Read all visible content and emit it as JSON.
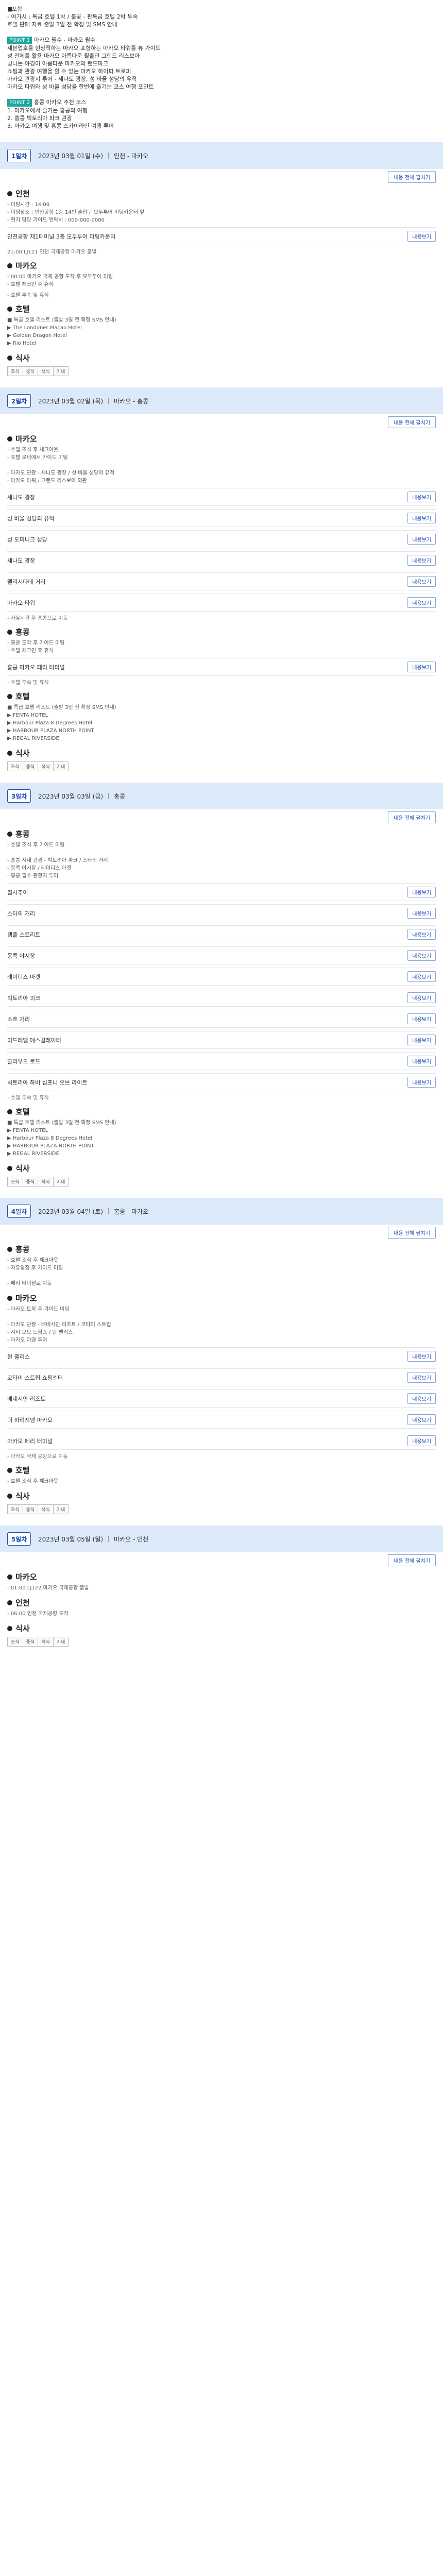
{
  "intro": {
    "lines": [
      {
        "type": "bullet",
        "text": "포함"
      },
      {
        "type": "plain",
        "text": " - 여가시 : 특급 호텔 1박 / 불꽃 - 판특급 호텔 2박 투숙"
      },
      {
        "type": "plain",
        "text": " 호텔 판매 자료 출발 3일 전 확정 및 SMS 안내"
      },
      {
        "type": "blank",
        "text": ""
      },
      {
        "type": "badge",
        "badge": "POINT 1",
        "text": "마카오 필수 - 마카오 필수"
      },
      {
        "type": "plain",
        "text": " 세븐업호를 현상적하는 마카오 포함하는 마카오 타워를 뷰 가이드"
      },
      {
        "type": "plain",
        "text": " 성 전체를 활용 마카오 아름다운 월출인 그랜드 리스보아"
      },
      {
        "type": "plain",
        "text": " 빛나는 야경이 아름다운 마카오의 랜드마크"
      },
      {
        "type": "plain",
        "text": " 쇼핑과 관광 여행을 할 수 있는 마카오 하이파 트로피"
      },
      {
        "type": "plain",
        "text": " 마카오 관광지 투어 - 세나도 광장, 성 바울 성당의 유적"
      },
      {
        "type": "plain",
        "text": " 마카오 타워와 성 바울 성당을 한번에 즐기는 코스 여행 포인트"
      },
      {
        "type": "blank",
        "text": ""
      },
      {
        "type": "badge",
        "badge": "POINT 2",
        "text": "홍콩 마카오 추천 코스"
      },
      {
        "type": "plain",
        "text": " 1. 마카오에서 즐기는 홍콩의 여행"
      },
      {
        "type": "plain",
        "text": " 2. 홍콩 빅토리아 파크 관광"
      },
      {
        "type": "plain",
        "text": " 3. 마카오 여행 및 홍콩 스카이라인 여행 투어"
      }
    ]
  },
  "toggle_label": "내용 전체 펼치기",
  "detail_label": "내용보기",
  "days": [
    {
      "badge": "1일차",
      "date": "2023년 03월 01일 (수)",
      "route": "인천 - 마카오",
      "sections": [
        {
          "title": "인천",
          "info": [
            "- 미팅시간 : 14:00",
            "- 미팅장소 : 인천공항 1층 14번 출입구 모두투어 미팅카운터 앞",
            "- 현지 담당 가이드 연락처 : 000-000-0000"
          ],
          "rows": [
            {
              "label": "인천공항 제1터미널 3층 모두투어 미팅카운터"
            }
          ],
          "note": "21:00 LJ121 인천 국제공항 마카오 출발"
        },
        {
          "title": "마카오",
          "info": [
            "- 00:00 마카오 국제 공항 도착 후 모두투어 미팅",
            "- 호텔 체크인 후 휴식"
          ],
          "rows": [],
          "note": "- 호텔 투숙 및 휴식"
        },
        {
          "title": "호텔",
          "info": [
            "■ 특급 호텔 리스트 (출발 3일 전 확정 SMS 안내)",
            "▶ The Londoner Macao Hotel",
            "▶ Golden Dragon Hotel",
            "▶ Rio Hotel"
          ],
          "rows": [],
          "note": ""
        },
        {
          "title": "식사",
          "info": [],
          "rows": [],
          "note": ""
        }
      ],
      "meals": [
        "조식",
        "중식",
        "석식",
        "기내"
      ]
    },
    {
      "badge": "2일차",
      "date": "2023년 03월 02일 (목)",
      "route": "마카오 - 홍콩",
      "sections": [
        {
          "title": "마카오",
          "info": [
            "- 호텔 조식 후 체크아웃",
            "- 호텔 로비에서 가이드 미팅",
            "",
            "- 마카오 관광 - 세나도 광장 / 성 바울 성당의 유적",
            "- 마카오 타워 / 그랜드 리스보아 외관"
          ],
          "rows": [
            {
              "label": "세나도 광장"
            },
            {
              "label": "성 바울 성당의 유적"
            },
            {
              "label": "성 도미니크 성당"
            },
            {
              "label": "세나도 광장"
            },
            {
              "label": "펠리시다데 거리"
            },
            {
              "label": "마카오 타워"
            }
          ],
          "note": "- 자유시간 후 홍콩으로 이동"
        },
        {
          "title": "홍콩",
          "info": [
            "- 홍콩 도착 후 가이드 미팅",
            "- 호텔 체크인 후 휴식"
          ],
          "rows": [
            {
              "label": "홍콩 마카오 페리 터미널"
            }
          ],
          "note": "- 호텔 투숙 및 휴식"
        },
        {
          "title": "호텔",
          "info": [
            "■ 특급 호텔 리스트 (출발 3일 전 확정 SMS 안내)",
            "▶ FENTA HOTEL",
            "▶ Harbour Plaza 8 Degrees Hotel",
            "▶ HARBOUR PLAZA NORTH POINT",
            "▶ REGAL RIVERSIDE"
          ],
          "rows": [],
          "note": ""
        },
        {
          "title": "식사",
          "info": [],
          "rows": [],
          "note": ""
        }
      ],
      "meals": [
        "조식",
        "중식",
        "석식",
        "기내"
      ]
    },
    {
      "badge": "3일차",
      "date": "2023년 03월 03일 (금)",
      "route": "홍콩",
      "sections": [
        {
          "title": "홍콩",
          "info": [
            "- 호텔 조식 후 가이드 미팅",
            "",
            "- 홍콩 시내 관광 - 빅토리아 파크 / 스타의 거리",
            "- 몽콕 야시장 / 레이디스 마켓",
            "- 홍콩 필수 관광지 투어"
          ],
          "rows": [
            {
              "label": "침사추이"
            },
            {
              "label": "스타의 거리"
            },
            {
              "label": "템플 스트리트"
            },
            {
              "label": "몽콕 야시장"
            },
            {
              "label": "레이디스 마켓"
            },
            {
              "label": "빅토리아 피크"
            },
            {
              "label": "소호 거리"
            },
            {
              "label": "미드레벨 에스컬레이터"
            },
            {
              "label": "할리우드 로드"
            },
            {
              "label": "빅토리아 하버 심포니 오브 라이트"
            }
          ],
          "note": "- 호텔 투숙 및 휴식"
        },
        {
          "title": "호텔",
          "info": [
            "■ 특급 호텔 리스트 (출발 3일 전 확정 SMS 안내)",
            "▶ FENTA HOTEL",
            "▶ Harbour Plaza 8 Degrees Hotel",
            "▶ HARBOUR PLAZA NORTH POINT",
            "▶ REGAL RIVERSIDE"
          ],
          "rows": [],
          "note": ""
        },
        {
          "title": "식사",
          "info": [],
          "rows": [],
          "note": ""
        }
      ],
      "meals": [
        "조식",
        "중식",
        "석식",
        "기내"
      ]
    },
    {
      "badge": "4일차",
      "date": "2023년 03월 04일 (토)",
      "route": "홍콩 - 마카오",
      "sections": [
        {
          "title": "홍콩",
          "info": [
            "- 호텔 조식 후 체크아웃",
            "- 자유일정 후 가이드 미팅",
            "",
            "- 페리 터미널로 이동"
          ],
          "rows": [],
          "note": ""
        },
        {
          "title": "마카오",
          "info": [
            "- 마카오 도착 후 가이드 미팅",
            "",
            "- 마카오 관광 - 베네시안 리조트 / 코타이 스트립",
            "- 시티 오브 드림즈 / 윈 팰리스",
            "- 마카오 야경 투어"
          ],
          "rows": [
            {
              "label": "윈 팰리스"
            },
            {
              "label": "코타이 스트립 쇼핑센터"
            },
            {
              "label": "베네시안 리조트"
            },
            {
              "label": "더 파리지앵 마카오"
            },
            {
              "label": "마카오 페리 터미널"
            }
          ],
          "note": "- 마카오 국제 공항으로 이동"
        },
        {
          "title": "호텔",
          "info": [
            "- 호텔 조식 후 체크아웃"
          ],
          "rows": [],
          "note": ""
        },
        {
          "title": "식사",
          "info": [],
          "rows": [],
          "note": ""
        }
      ],
      "meals": [
        "조식",
        "중식",
        "석식",
        "기내"
      ]
    },
    {
      "badge": "5일차",
      "date": "2023년 03월 05일 (일)",
      "route": "마카오 - 인천",
      "sections": [
        {
          "title": "마카오",
          "info": [
            "- 01:00 LJ122 마카오 국제공항 출발"
          ],
          "rows": [],
          "note": ""
        },
        {
          "title": "인천",
          "info": [
            "- 06:00 인천 국제공항 도착"
          ],
          "rows": [],
          "note": ""
        },
        {
          "title": "식사",
          "info": [],
          "rows": [],
          "note": ""
        }
      ],
      "meals": [
        "조식",
        "중식",
        "석식",
        "기내"
      ]
    }
  ]
}
